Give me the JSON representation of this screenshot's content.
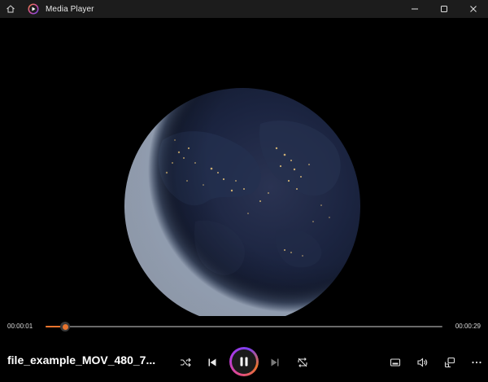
{
  "window": {
    "title": "Media Player",
    "home_icon": "home-icon",
    "app_icon": "media-player-logo-icon",
    "controls": [
      "minimize-icon",
      "maximize-icon",
      "close-icon"
    ]
  },
  "video": {
    "content": "earth-at-night-globe"
  },
  "playback": {
    "current_time": "00:00:01",
    "total_time": "00:00:29",
    "progress_fraction": 0.05,
    "state": "playing"
  },
  "media": {
    "file_title": "file_example_MOV_480_7..."
  },
  "controls": {
    "left": [
      "shuffle-icon",
      "previous-icon",
      "pause-icon",
      "next-icon",
      "repeat-off-icon"
    ],
    "right": [
      "mini-view-icon",
      "volume-icon",
      "cast-icon",
      "more-options-icon"
    ]
  },
  "colors": {
    "accent": "#e9742e",
    "titlebar_bg": "#1c1c1c",
    "background": "#000000"
  }
}
